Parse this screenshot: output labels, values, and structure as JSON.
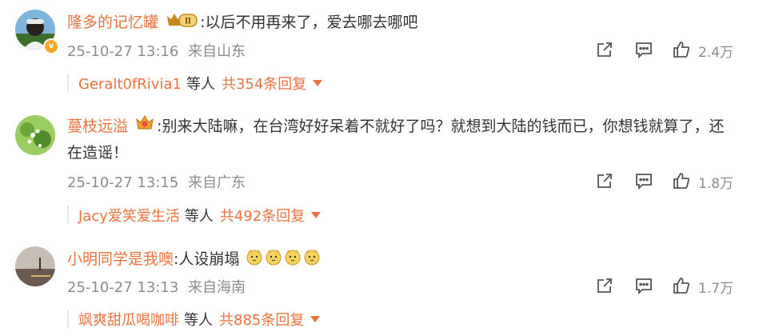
{
  "comments": [
    {
      "username": "隆多的记忆罐",
      "text": ":以后不用再来了，爱去哪去哪吧",
      "time": "25-10-27 13:16",
      "location": "来自山东",
      "likes": "2.4万",
      "reply_user": "Geralt0fRivia1",
      "reply_mid": "等人",
      "reply_count": "共354条回复",
      "avatar_colors": [
        "#6aa9d8",
        "#3a6f2c",
        "#222222"
      ],
      "badge_label": "Ⅱ"
    },
    {
      "username": "蔓枝远溢",
      "text": ":别来大陆嘛，在台湾好好呆着不就好了吗？就想到大陆的钱而已，你想钱就算了，还在造谣！",
      "time": "25-10-27 13:15",
      "location": "来自广东",
      "likes": "1.8万",
      "reply_user": "Jacy爱笑爱生活",
      "reply_mid": "等人",
      "reply_count": "共492条回复",
      "avatar_colors": [
        "#a5d46a",
        "#5e9a3a",
        "#f2f2f2"
      ]
    },
    {
      "username": "小明同学是我噢",
      "text": ":人设崩塌",
      "time": "25-10-27 13:13",
      "location": "来自海南",
      "likes": "1.7万",
      "reply_user": "飒爽甜瓜喝咖啡",
      "reply_mid": "等人",
      "reply_count": "共885条回复",
      "avatar_colors": [
        "#b8b0a8",
        "#5a4a42",
        "#e8d8c8"
      ]
    }
  ],
  "icons": {
    "share": "share-icon",
    "comment": "comment-icon",
    "like": "like-icon",
    "verified": "verified-v-icon"
  },
  "colors": {
    "username": "#eb7340",
    "meta": "#8c8c8c",
    "text": "#333333"
  }
}
